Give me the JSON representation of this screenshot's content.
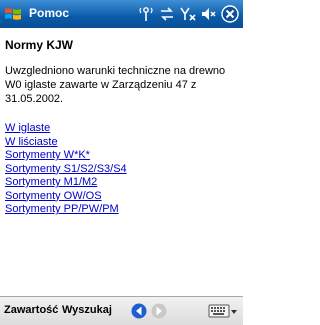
{
  "window": {
    "title": "Pomoc"
  },
  "status_icons": [
    "signal-icon",
    "sync-icon",
    "no-signal-icon",
    "speaker-icon",
    "close-icon"
  ],
  "content": {
    "heading": "Normy KJW",
    "paragraph": "Uwzgledniono warunki techniczne na drewno W0 iglaste zawarte w Zarządzeniu 47 z 31.05.2002.",
    "links": [
      "W iglaste",
      "W liściaste",
      "Sortymenty W*K*",
      "Sortymenty S1/S2/S3/S4",
      "Sortymenty M1/M2",
      "Sortymenty OW/OS",
      "Sortymenty PP/PW/PM"
    ]
  },
  "menubar": {
    "left_label": "Zawartość",
    "right_label": "Wyszukaj"
  },
  "colors": {
    "titlebar": "#0a5aa8",
    "link": "#0000cc",
    "nav_arrow": "#1e5fd0"
  }
}
